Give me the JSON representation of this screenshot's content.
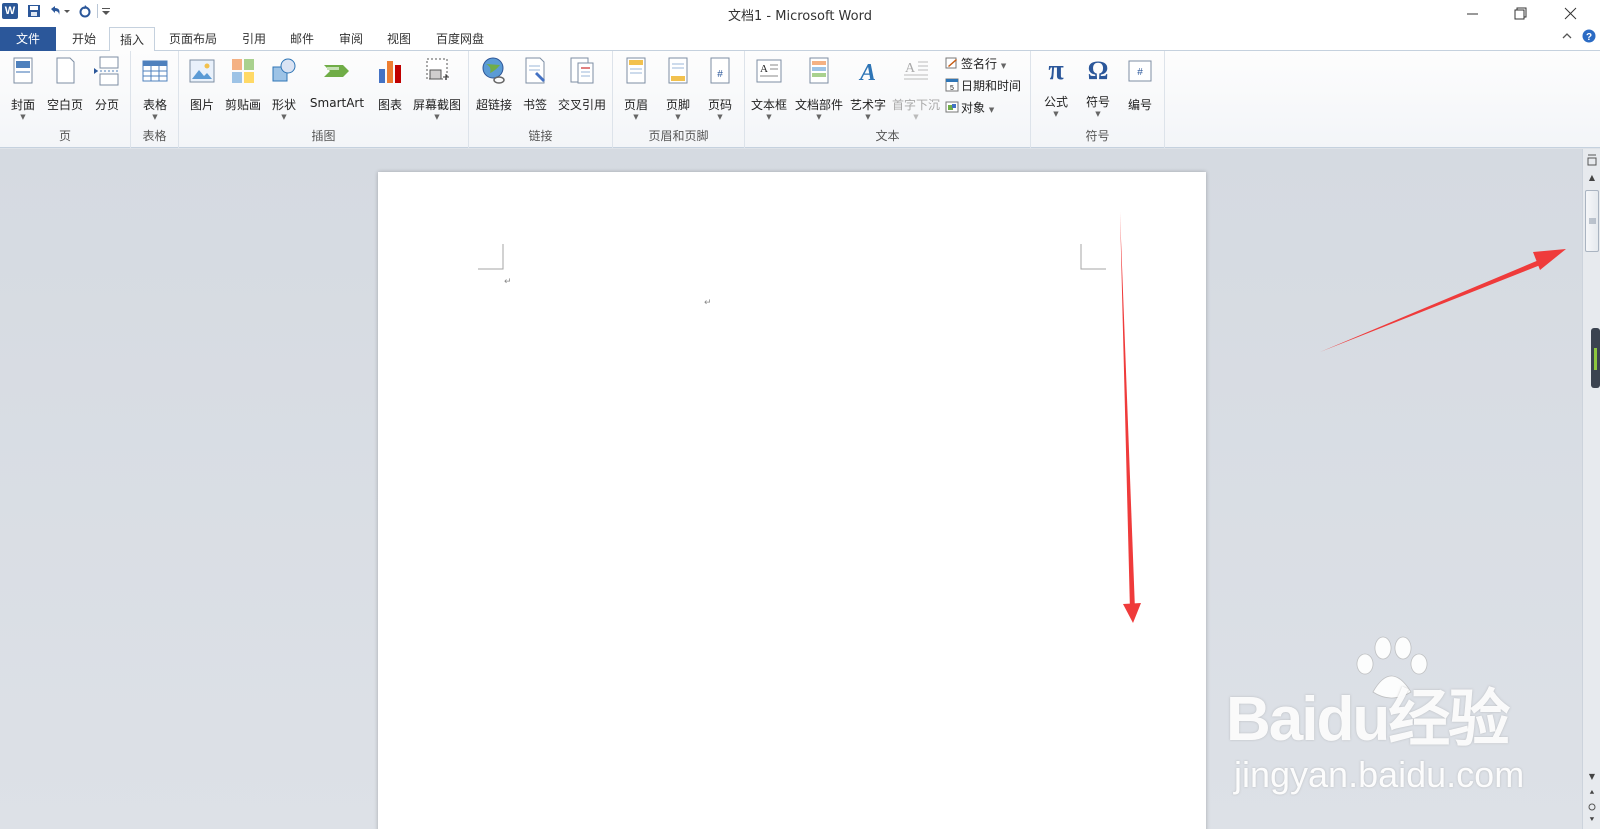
{
  "window": {
    "title": "文档1 - Microsoft Word",
    "app_icon": "W"
  },
  "quick_access": [
    "save-icon",
    "undo-icon",
    "redo-icon",
    "customize-icon"
  ],
  "tabs": {
    "file": "文件",
    "items": [
      "开始",
      "插入",
      "页面布局",
      "引用",
      "邮件",
      "审阅",
      "视图",
      "百度网盘"
    ],
    "active": "插入"
  },
  "ribbon": {
    "groups": {
      "pages": {
        "label": "页",
        "buttons": [
          "封面",
          "空白页",
          "分页"
        ]
      },
      "tables": {
        "label": "表格",
        "buttons": [
          "表格"
        ]
      },
      "illustrations": {
        "label": "插图",
        "buttons": [
          "图片",
          "剪贴画",
          "形状",
          "SmartArt",
          "图表",
          "屏幕截图"
        ]
      },
      "links": {
        "label": "链接",
        "buttons": [
          "超链接",
          "书签",
          "交叉引用"
        ]
      },
      "header_footer": {
        "label": "页眉和页脚",
        "buttons": [
          "页眉",
          "页脚",
          "页码"
        ]
      },
      "text": {
        "label": "文本",
        "buttons": [
          "文本框",
          "文档部件",
          "艺术字",
          "首字下沉"
        ],
        "small_buttons": [
          "签名行",
          "日期和时间",
          "对象"
        ]
      },
      "symbols": {
        "label": "符号",
        "buttons": [
          "公式",
          "符号",
          "编号"
        ],
        "glyphs": [
          "π",
          "Ω",
          "#"
        ]
      }
    }
  },
  "document": {
    "paragraph_mark": "↵"
  },
  "watermark": {
    "logo": "Baidu经验",
    "url": "jingyan.baidu.com"
  },
  "colors": {
    "file_tab": "#2b579a",
    "annotation_arrow": "#ef3b3b",
    "doc_background": "#dfe3e8"
  }
}
